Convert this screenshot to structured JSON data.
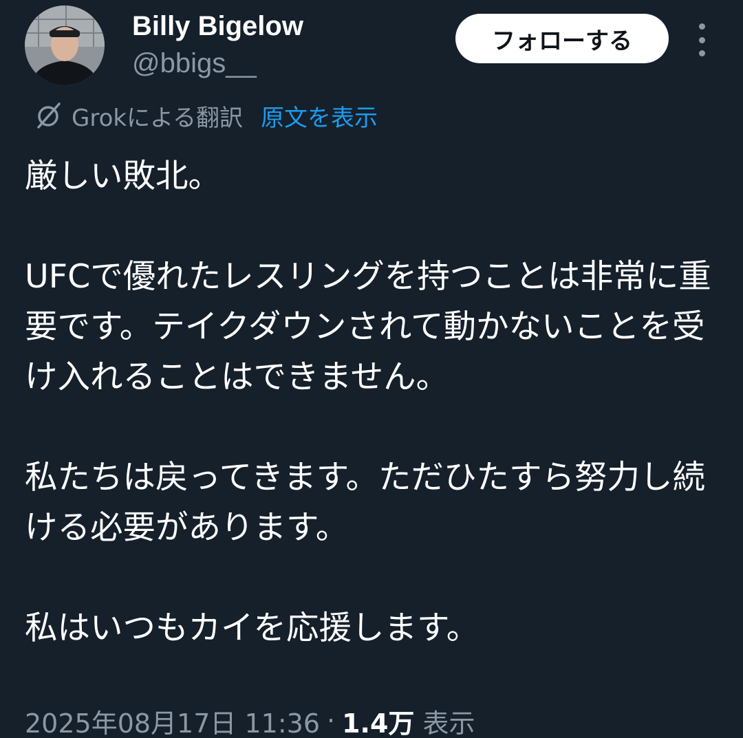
{
  "user": {
    "display_name": "Billy Bigelow",
    "handle": "@bbigs__",
    "avatar_icon": "profile-photo"
  },
  "actions": {
    "follow_label": "フォローする",
    "more_icon": "more-vertical-icon"
  },
  "translation": {
    "icon": "grok-icon",
    "label": "Grokによる翻訳",
    "show_original": "原文を表示"
  },
  "tweet": {
    "text": "厳しい敗北。\n\nUFCで優れたレスリングを持つことは非常に重要です。テイクダウンされて動かないことを受け入れることはできません。\n\n私たちは戻ってきます。ただひたすら努力し続ける必要があります。\n\n私はいつもカイを応援します。"
  },
  "meta": {
    "timestamp": "2025年08月17日 11:36",
    "separator": "·",
    "views_count": "1.4万",
    "views_label": "表示"
  },
  "colors": {
    "background": "#15202b",
    "secondary_text": "#8b98a5",
    "link": "#1d9bf0",
    "follow_bg": "#ffffff"
  }
}
